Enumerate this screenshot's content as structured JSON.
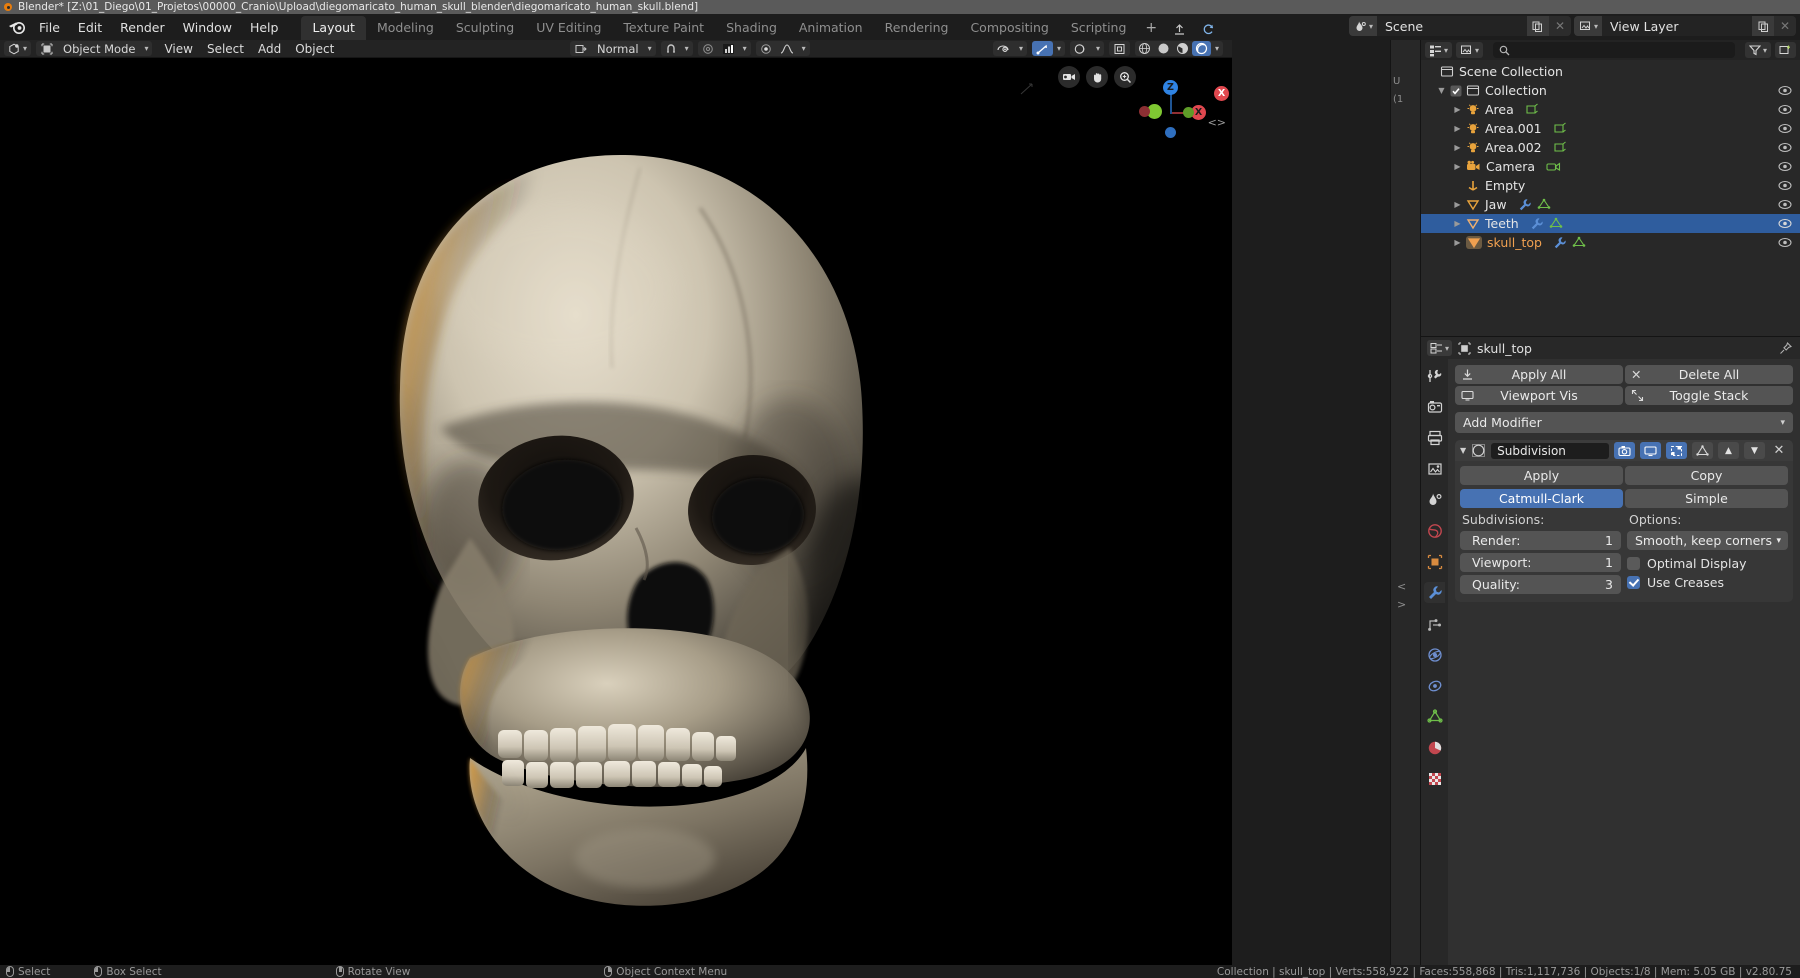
{
  "window": {
    "title": "Blender* [Z:\\01_Diego\\01_Projetos\\00000_Cranio\\Upload\\diegomaricato_human_skull_blender\\diegomaricato_human_skull.blend]"
  },
  "topbar": {
    "menus": [
      "File",
      "Edit",
      "Render",
      "Window",
      "Help"
    ],
    "workspaces": [
      {
        "label": "Layout",
        "active": true
      },
      {
        "label": "Modeling",
        "active": false
      },
      {
        "label": "Sculpting",
        "active": false
      },
      {
        "label": "UV Editing",
        "active": false
      },
      {
        "label": "Texture Paint",
        "active": false
      },
      {
        "label": "Shading",
        "active": false
      },
      {
        "label": "Animation",
        "active": false
      },
      {
        "label": "Rendering",
        "active": false
      },
      {
        "label": "Compositing",
        "active": false
      },
      {
        "label": "Scripting",
        "active": false
      }
    ],
    "add_workspace": "+",
    "scene_name": "Scene",
    "view_layer_name": "View Layer"
  },
  "viewport": {
    "mode": "Object Mode",
    "menus": [
      "View",
      "Select",
      "Add",
      "Object"
    ],
    "transform_orientation": "Normal",
    "overlay_label": "",
    "gizmo": {
      "x": "X",
      "y": "Y",
      "z": "Z"
    },
    "shading_modes": [
      "wireframe",
      "solid",
      "material-preview",
      "rendered"
    ],
    "active_shading": "rendered"
  },
  "outliner": {
    "search_value": "",
    "root": "Scene Collection",
    "collection": "Collection",
    "items": [
      {
        "label": "Area",
        "type": "light",
        "selected": false,
        "active": false,
        "icons": [
          "light-data"
        ]
      },
      {
        "label": "Area.001",
        "type": "light",
        "selected": false,
        "active": false,
        "icons": [
          "light-data"
        ]
      },
      {
        "label": "Area.002",
        "type": "light",
        "selected": false,
        "active": false,
        "icons": [
          "light-data"
        ]
      },
      {
        "label": "Camera",
        "type": "camera",
        "selected": false,
        "active": false,
        "icons": [
          "camera-data"
        ]
      },
      {
        "label": "Empty",
        "type": "empty",
        "selected": false,
        "active": false,
        "icons": []
      },
      {
        "label": "Jaw",
        "type": "mesh",
        "selected": false,
        "active": false,
        "icons": [
          "modifier",
          "mesh-data"
        ]
      },
      {
        "label": "Teeth",
        "type": "mesh",
        "selected": true,
        "active": false,
        "icons": [
          "modifier",
          "mesh-data"
        ]
      },
      {
        "label": "skull_top",
        "type": "mesh",
        "selected": false,
        "active": true,
        "icons": [
          "modifier",
          "mesh-data"
        ]
      }
    ]
  },
  "properties": {
    "breadcrumb_object": "skull_top",
    "tabs": [
      "tool",
      "render",
      "output",
      "view-layer",
      "scene",
      "world",
      "object",
      "modifier",
      "particles",
      "physics",
      "constraints",
      "data",
      "material",
      "texture"
    ],
    "active_tab": "modifier",
    "apply_all_label": "Apply All",
    "delete_all_label": "Delete All",
    "viewport_vis_label": "Viewport Vis",
    "toggle_stack_label": "Toggle Stack",
    "add_modifier_label": "Add Modifier",
    "modifier": {
      "name": "Subdivision",
      "apply_label": "Apply",
      "copy_label": "Copy",
      "algorithm_options": [
        "Catmull-Clark",
        "Simple"
      ],
      "algorithm_active": "Catmull-Clark",
      "subdivisions_label": "Subdivisions:",
      "options_label": "Options:",
      "render_label": "Render:",
      "render_value": "1",
      "viewport_label": "Viewport:",
      "viewport_value": "1",
      "quality_label": "Quality:",
      "quality_value": "3",
      "uv_smooth_value": "Smooth, keep corners",
      "optimal_display_label": "Optimal Display",
      "optimal_display_checked": false,
      "use_creases_label": "Use Creases",
      "use_creases_checked": true,
      "display_toggles": [
        {
          "name": "render",
          "on": true
        },
        {
          "name": "realtime",
          "on": true
        },
        {
          "name": "edit-mode",
          "on": true
        },
        {
          "name": "on-cage",
          "on": false
        }
      ]
    }
  },
  "statusbar": {
    "hints": [
      {
        "mouse": "left",
        "label": "Select"
      },
      {
        "mouse": "left-drag",
        "label": "Box Select"
      },
      {
        "mouse": "middle",
        "label": "Rotate View"
      },
      {
        "mouse": "right",
        "label": "Object Context Menu"
      }
    ],
    "info": "Collection | skull_top | Verts:558,922 | Faces:558,868 | Tris:1,117,736 | Objects:1/8 | Mem: 5.05 GB | v2.80.75"
  },
  "colors": {
    "accent_blue": "#4772b3",
    "active_orange": "#f0a050",
    "axis_x": "#e0484f",
    "axis_y": "#7fc832",
    "axis_z": "#2f83e3"
  }
}
